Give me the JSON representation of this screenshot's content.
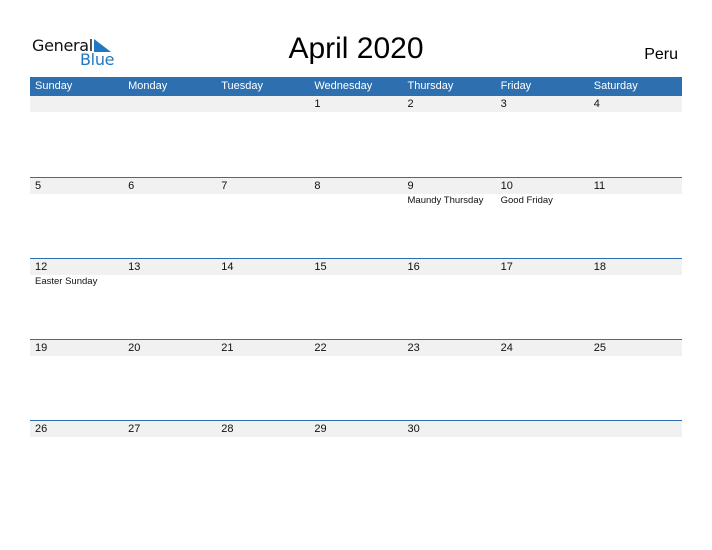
{
  "logo": {
    "line1": "General",
    "line2": "Blue"
  },
  "title": "April 2020",
  "country": "Peru",
  "colors": {
    "accent": "#2e6fb0",
    "logo_blue": "#1f78c1",
    "row_strip": "#f1f1f1"
  },
  "weekdays": [
    "Sunday",
    "Monday",
    "Tuesday",
    "Wednesday",
    "Thursday",
    "Friday",
    "Saturday"
  ],
  "weeks": [
    {
      "days": [
        {
          "num": "",
          "event": ""
        },
        {
          "num": "",
          "event": ""
        },
        {
          "num": "",
          "event": ""
        },
        {
          "num": "1",
          "event": ""
        },
        {
          "num": "2",
          "event": ""
        },
        {
          "num": "3",
          "event": ""
        },
        {
          "num": "4",
          "event": ""
        }
      ]
    },
    {
      "days": [
        {
          "num": "5",
          "event": ""
        },
        {
          "num": "6",
          "event": ""
        },
        {
          "num": "7",
          "event": ""
        },
        {
          "num": "8",
          "event": ""
        },
        {
          "num": "9",
          "event": "Maundy Thursday"
        },
        {
          "num": "10",
          "event": "Good Friday"
        },
        {
          "num": "11",
          "event": ""
        }
      ]
    },
    {
      "days": [
        {
          "num": "12",
          "event": "Easter Sunday"
        },
        {
          "num": "13",
          "event": ""
        },
        {
          "num": "14",
          "event": ""
        },
        {
          "num": "15",
          "event": ""
        },
        {
          "num": "16",
          "event": ""
        },
        {
          "num": "17",
          "event": ""
        },
        {
          "num": "18",
          "event": ""
        }
      ]
    },
    {
      "days": [
        {
          "num": "19",
          "event": ""
        },
        {
          "num": "20",
          "event": ""
        },
        {
          "num": "21",
          "event": ""
        },
        {
          "num": "22",
          "event": ""
        },
        {
          "num": "23",
          "event": ""
        },
        {
          "num": "24",
          "event": ""
        },
        {
          "num": "25",
          "event": ""
        }
      ]
    },
    {
      "days": [
        {
          "num": "26",
          "event": ""
        },
        {
          "num": "27",
          "event": ""
        },
        {
          "num": "28",
          "event": ""
        },
        {
          "num": "29",
          "event": ""
        },
        {
          "num": "30",
          "event": ""
        },
        {
          "num": "",
          "event": ""
        },
        {
          "num": "",
          "event": ""
        }
      ]
    }
  ]
}
